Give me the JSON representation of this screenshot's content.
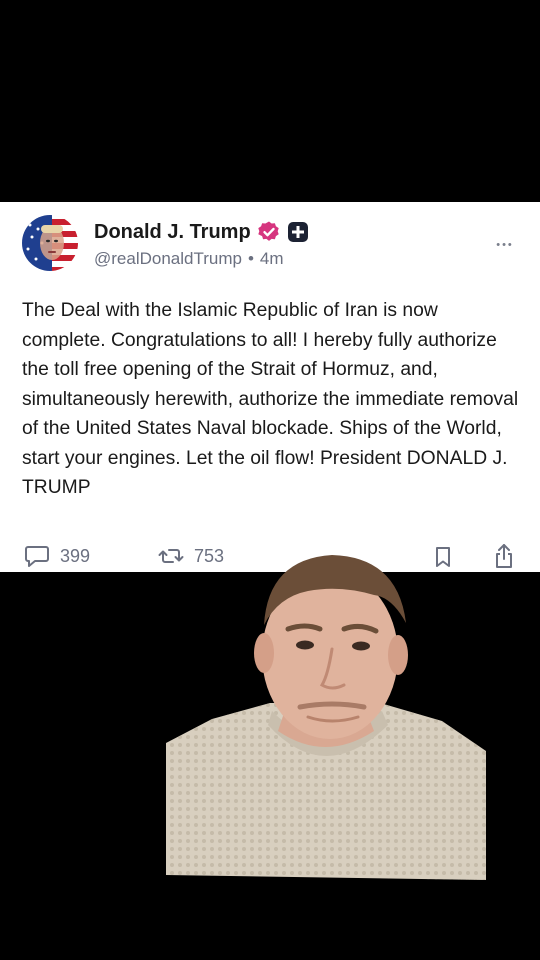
{
  "post": {
    "author_name": "Donald J. Trump",
    "handle": "@realDonaldTrump",
    "separator": "•",
    "time_ago": "4m",
    "more_label": "•••",
    "body": "The Deal with the Islamic Republic of Iran is now complete. Congratulations to all! I hereby fully authorize the toll free opening of the Strait of Hormuz, and, simultaneously herewith, authorize the immediate removal of the United States Naval blockade. Ships of the World, start your engines. Let the oil flow! President DONALD J. TRUMP",
    "reply_count": "399",
    "retruth_count": "753"
  },
  "icons": {
    "avatar": "avatar-image",
    "verified": "verified-badge-icon",
    "plus": "plus-badge-icon",
    "reply": "comment-icon",
    "retruth": "repost-icon",
    "bookmark": "bookmark-icon",
    "share": "share-icon"
  },
  "colors": {
    "verified_badge": "#d6357f",
    "muted_text": "#6b7080",
    "background": "#000000",
    "card": "#ffffff"
  }
}
